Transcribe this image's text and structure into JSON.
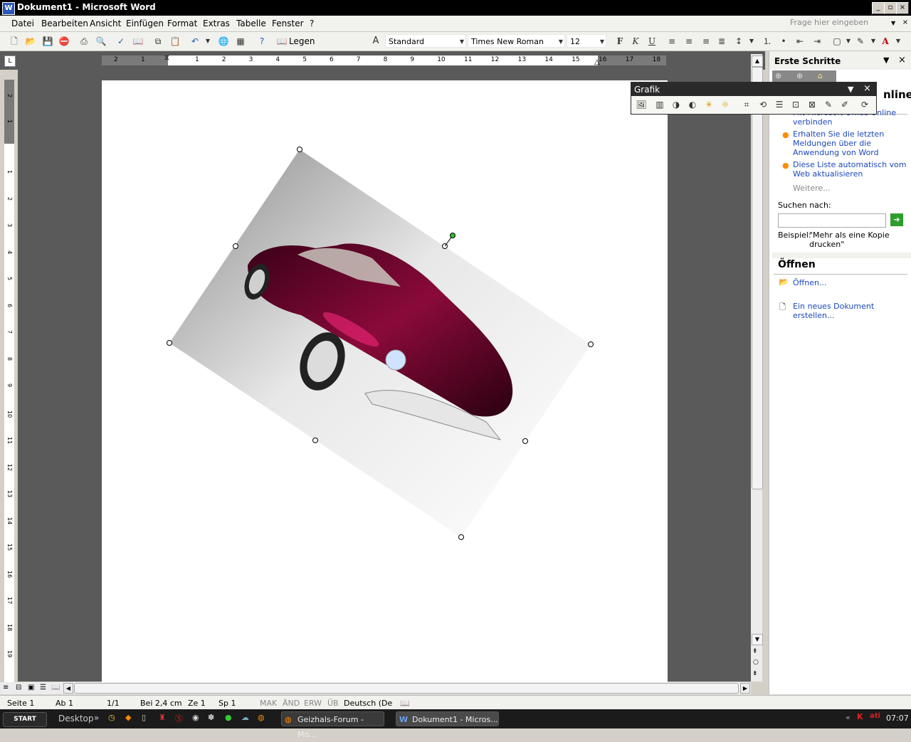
{
  "window": {
    "title": "Dokument1 - Microsoft Word"
  },
  "menu": {
    "items": [
      "Datei",
      "Bearbeiten",
      "Ansicht",
      "Einfügen",
      "Format",
      "Extras",
      "Tabelle",
      "Fenster",
      "?"
    ],
    "help_placeholder": "Frage hier eingeben"
  },
  "toolbar": {
    "read_label": "Legen",
    "style": "Standard",
    "font": "Times New Roman",
    "size": "12",
    "bold": "F",
    "italic": "K",
    "underline": "U",
    "font_color_letter": "A",
    "colors": {
      "font_color": "#e00000",
      "highlight": "#ffff00"
    }
  },
  "ruler": {
    "h_ticks": [
      "2",
      "1",
      "1",
      "2",
      "3",
      "4",
      "5",
      "6",
      "7",
      "8",
      "9",
      "10",
      "11",
      "12",
      "13",
      "14",
      "15",
      "16",
      "17",
      "18"
    ],
    "v_ticks": [
      "2",
      "1",
      "1",
      "2",
      "3",
      "4",
      "5",
      "6",
      "7",
      "8",
      "9",
      "10",
      "11",
      "12",
      "13",
      "14",
      "15",
      "16",
      "17",
      "18",
      "19"
    ]
  },
  "grafik_toolbar": {
    "title": "Grafik"
  },
  "task_pane": {
    "title": "Erste Schritte",
    "section_online_fragment": "nline",
    "bullets": [
      "Mit Microsoft Office Online verbinden",
      "Erhalten Sie die letzten Meldungen über die Anwendung von Word",
      "Diese Liste automatisch vom Web aktualisieren"
    ],
    "more": "Weitere...",
    "search_label": "Suchen nach:",
    "search_value": "",
    "example_label": "Beispiel:",
    "example_text": "\"Mehr als eine Kopie drucken\"",
    "open_heading": "Öffnen",
    "open_link": "Öffnen...",
    "new_doc_link": "Ein neues Dokument erstellen..."
  },
  "status": {
    "page": "Seite 1",
    "section": "Ab 1",
    "pages": "1/1",
    "position": "Bei 2,4 cm",
    "line": "Ze 1",
    "column": "Sp 1",
    "mak": "MAK",
    "aend": "ÄND",
    "erw": "ERW",
    "ueb": "ÜB",
    "language": "Deutsch (De"
  },
  "taskbar": {
    "start": "START",
    "desktop": "Desktop",
    "chevron": "»",
    "tasks": [
      "Geizhals-Forum - Mo...",
      "Dokument1 - Micros..."
    ],
    "clock": "07:07"
  }
}
